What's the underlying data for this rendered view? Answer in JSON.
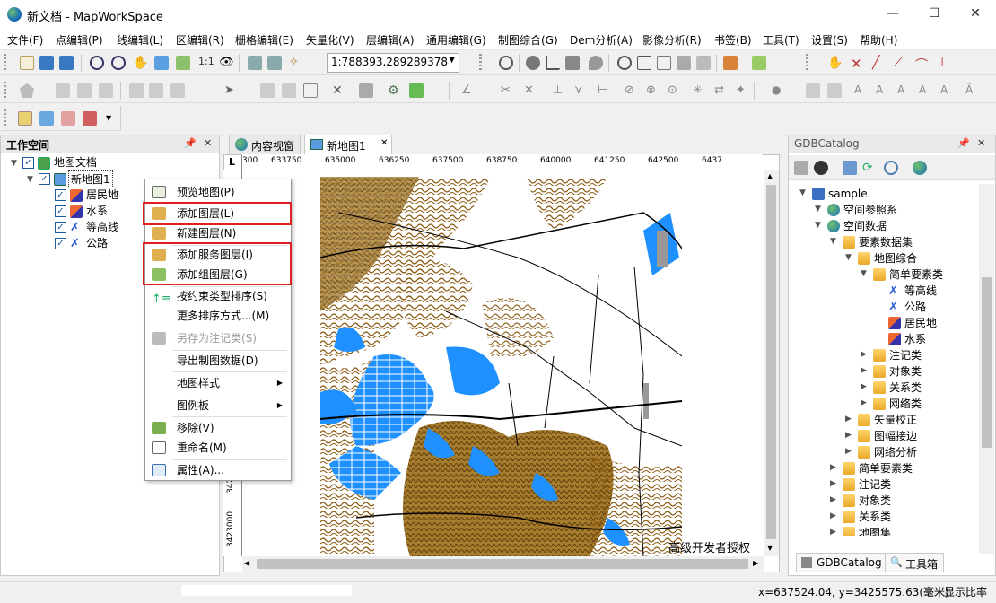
{
  "window": {
    "title": "新文档 - MapWorkSpace",
    "min": "—",
    "max": "☐",
    "close": "✕"
  },
  "menu": [
    "文件(F)",
    "点编辑(P)",
    "线编辑(L)",
    "区编辑(R)",
    "栅格编辑(E)",
    "矢量化(V)",
    "层编辑(A)",
    "通用编辑(G)",
    "制图综合(G)",
    "Dem分析(A)",
    "影像分析(R)",
    "书签(B)",
    "工具(T)",
    "设置(S)",
    "帮助(H)"
  ],
  "toolbar": {
    "zoom_ratio": "1:1",
    "scale_value": "1:788393.289289378"
  },
  "workspace": {
    "title": "工作空间",
    "pin": "ᵖ",
    "close": "✕",
    "tree": {
      "root": "地图文档",
      "map": "新地图1",
      "layers": [
        "居民地",
        "水系",
        "等高线",
        "公路"
      ]
    }
  },
  "context_menu": {
    "items": [
      {
        "label": "预览地图(P)",
        "disabled": false
      },
      {
        "label": "添加图层(L)",
        "disabled": false
      },
      {
        "label": "新建图层(N)",
        "disabled": false
      },
      {
        "label": "添加服务图层(I)",
        "disabled": false
      },
      {
        "label": "添加组图层(G)",
        "disabled": false
      },
      {
        "label": "按约束类型排序(S)",
        "disabled": false
      },
      {
        "label": "更多排序方式...(M)",
        "disabled": false
      },
      {
        "label": "另存为注记类(S)",
        "disabled": true
      },
      {
        "label": "导出制图数据(D)",
        "disabled": false
      },
      {
        "label": "地图样式",
        "disabled": false,
        "submenu": true
      },
      {
        "label": "图例板",
        "disabled": false,
        "submenu": true
      },
      {
        "label": "移除(V)",
        "disabled": false
      },
      {
        "label": "重命名(M)",
        "disabled": false
      },
      {
        "label": "属性(A)...",
        "disabled": false
      }
    ]
  },
  "doc_tabs": [
    {
      "label": "内容视窗"
    },
    {
      "label": "新地图1",
      "close": "✕"
    }
  ],
  "ruler": {
    "top": [
      "300",
      "633750",
      "635000",
      "636250",
      "637500",
      "638750",
      "640000",
      "641250",
      "642500",
      "6437"
    ],
    "left": [
      "3423000",
      "342"
    ]
  },
  "map": {
    "watermark": "高级开发者授权"
  },
  "gdb": {
    "title": "GDBCatalog",
    "tree": [
      {
        "label": "sample",
        "level": 0,
        "type": "db"
      },
      {
        "label": "空间参照系",
        "level": 1,
        "type": "globe"
      },
      {
        "label": "空间数据",
        "level": 1,
        "type": "globe"
      },
      {
        "label": "要素数据集",
        "level": 2,
        "type": "folder"
      },
      {
        "label": "地图综合",
        "level": 3,
        "type": "folder"
      },
      {
        "label": "简单要素类",
        "level": 4,
        "type": "folder"
      },
      {
        "label": "等高线",
        "level": 5,
        "type": "line"
      },
      {
        "label": "公路",
        "level": 5,
        "type": "line"
      },
      {
        "label": "居民地",
        "level": 5,
        "type": "poly"
      },
      {
        "label": "水系",
        "level": 5,
        "type": "poly"
      },
      {
        "label": "注记类",
        "level": 4,
        "type": "folder"
      },
      {
        "label": "对象类",
        "level": 4,
        "type": "folder"
      },
      {
        "label": "关系类",
        "level": 4,
        "type": "folder"
      },
      {
        "label": "网络类",
        "level": 4,
        "type": "folder"
      },
      {
        "label": "矢量校正",
        "level": 3,
        "type": "folder"
      },
      {
        "label": "图幅接边",
        "level": 3,
        "type": "folder"
      },
      {
        "label": "网络分析",
        "level": 3,
        "type": "folder"
      },
      {
        "label": "简单要素类",
        "level": 2,
        "type": "folder"
      },
      {
        "label": "注记类",
        "level": 2,
        "type": "folder"
      },
      {
        "label": "对象类",
        "level": 2,
        "type": "folder"
      },
      {
        "label": "关系类",
        "level": 2,
        "type": "folder"
      },
      {
        "label": "地图集",
        "level": 2,
        "type": "folder"
      }
    ],
    "tabs": [
      "GDBCatalog",
      "工具箱"
    ]
  },
  "status": {
    "coords": "x=637524.04, y=3425575.63(毫米)",
    "scale_label": "显示比率"
  },
  "colors": {
    "water": "#1e90ff",
    "contour": "#8b5a12",
    "highlight": "#e02020"
  }
}
